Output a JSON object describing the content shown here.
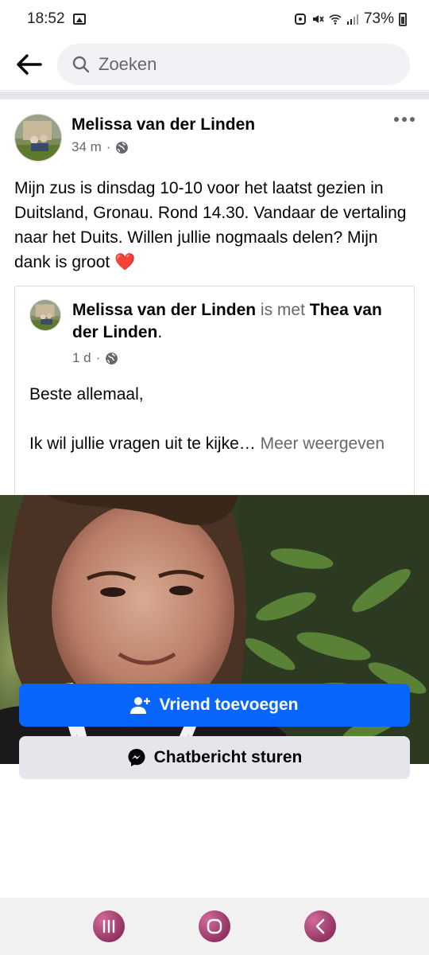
{
  "status_bar": {
    "time": "18:52",
    "battery": "73%",
    "icons": [
      "gallery-icon",
      "dnd-icon",
      "mute-icon",
      "wifi-call-icon",
      "signal-icon",
      "battery-icon"
    ]
  },
  "header": {
    "back_icon": "back-arrow-icon",
    "search_placeholder": "Zoeken"
  },
  "post": {
    "author": "Melissa van der Linden",
    "time": "34 m",
    "separator": "·",
    "audience_icon": "globe-icon",
    "text": "Mijn zus is dinsdag 10-10 voor het laatst gezien in Duitsland, Gronau. Rond 14.30. Vandaar de vertaling naar het Duits. Willen jullie nogmaals delen? Mijn dank is groot",
    "emoji": "❤️"
  },
  "shared_post": {
    "author": "Melissa van der Linden",
    "connector": "is met",
    "tagged": "Thea van der Linden",
    "period": ".",
    "time": "1 d",
    "separator": "·",
    "line1": "Beste allemaal,",
    "line2": "Ik wil jullie vragen uit te kijke…",
    "more": "Meer weergeven"
  },
  "actions": {
    "add_friend": "Vriend toevoegen",
    "message": "Chatbericht sturen"
  },
  "colors": {
    "primary": "#0866ff",
    "secondary_button": "#e4e6eb",
    "muted_text": "#65676b",
    "heart": "#e41e3f"
  }
}
